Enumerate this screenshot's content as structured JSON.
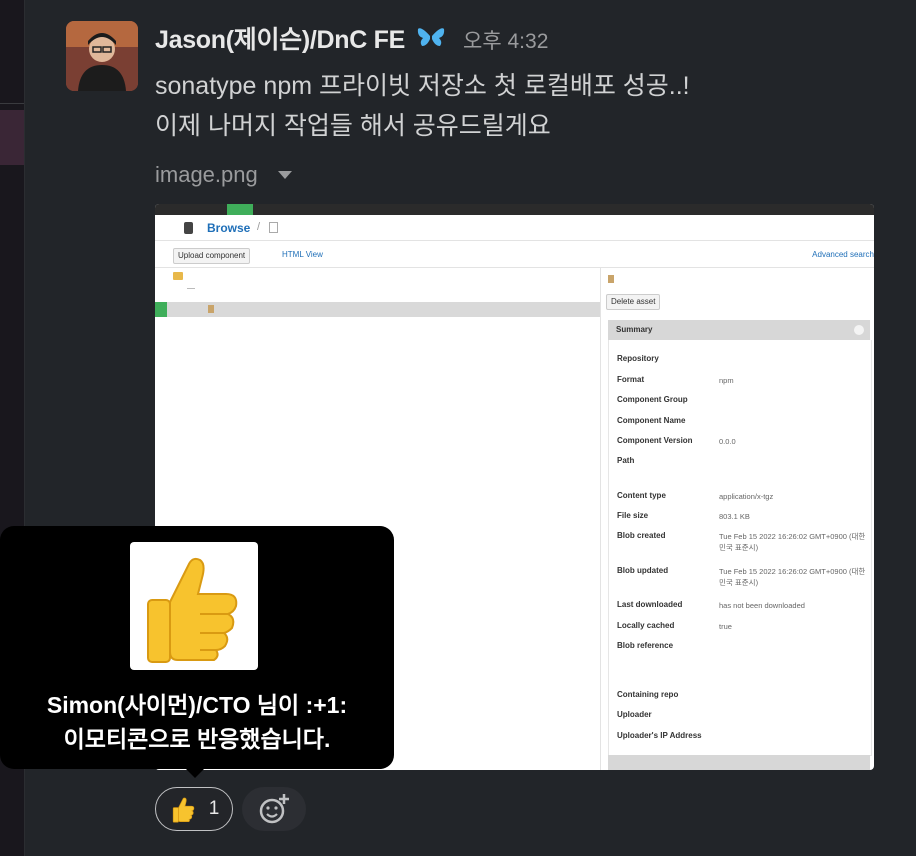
{
  "message": {
    "author": "Jason(제이슨)/DnC FE",
    "time": "오후 4:32",
    "lines": [
      "sonatype npm 프라이빗 저장소 첫 로컬배포 성공..!",
      "이제 나머지 작업들 해서 공유드릴게요"
    ],
    "attachment": {
      "name": "image.png"
    }
  },
  "screenshot": {
    "browse_title": "Browse",
    "breadcrumb_sep": "/",
    "upload_label": "Upload component",
    "html_view_label": "HTML View",
    "advanced_search_label": "Advanced search",
    "delete_label": "Delete asset",
    "summary_title": "Summary",
    "fields": [
      {
        "label": "Repository",
        "value": ""
      },
      {
        "label": "Format",
        "value": "npm"
      },
      {
        "label": "Component Group",
        "value": ""
      },
      {
        "label": "Component Name",
        "value": ""
      },
      {
        "label": "Component Version",
        "value": "0.0.0"
      },
      {
        "label": "Path",
        "value": ""
      },
      {
        "label": "Content type",
        "value": "application/x-tgz"
      },
      {
        "label": "File size",
        "value": "803.1 KB"
      },
      {
        "label": "Blob created",
        "value": "Tue Feb 15 2022 16:26:02 GMT+0900 (대한민국 표준시)"
      },
      {
        "label": "Blob updated",
        "value": "Tue Feb 15 2022 16:26:02 GMT+0900 (대한민국 표준시)"
      },
      {
        "label": "Last downloaded",
        "value": "has not been downloaded"
      },
      {
        "label": "Locally cached",
        "value": "true"
      },
      {
        "label": "Blob reference",
        "value": ""
      },
      {
        "label": "Containing repo",
        "value": ""
      },
      {
        "label": "Uploader",
        "value": ""
      },
      {
        "label": "Uploader's IP Address",
        "value": ""
      }
    ]
  },
  "tooltip": {
    "line1": "Simon(사이먼)/CTO 님이 :+1:",
    "line2": "이모티콘으로 반응했습니다."
  },
  "reactions": [
    {
      "emoji": "thumbs-up-icon",
      "count": "1"
    }
  ],
  "colors": {
    "background": "#222529",
    "link": "#1f6fb8",
    "success_green": "#3fae5a"
  }
}
